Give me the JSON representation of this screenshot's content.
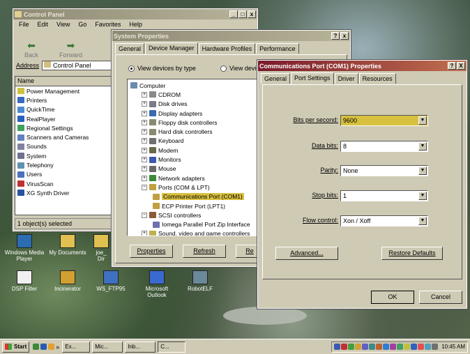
{
  "control_panel": {
    "title": "Control Panel",
    "menu": [
      "File",
      "Edit",
      "View",
      "Go",
      "Favorites",
      "Help"
    ],
    "nav": [
      "Back",
      "Forward"
    ],
    "address_label": "Address",
    "address_value": "Control Panel",
    "column_header": "Name",
    "items": [
      "Power Management",
      "Printers",
      "QuickTime",
      "RealPlayer",
      "Regional Settings",
      "Scanners and Cameras",
      "Sounds",
      "System",
      "Telephony",
      "Users",
      "VirusScan",
      "XG Synth Driver"
    ],
    "status": "1 object(s) selected"
  },
  "system_properties": {
    "title": "System Properties",
    "tabs": [
      "General",
      "Device Manager",
      "Hardware Profiles",
      "Performance"
    ],
    "view_by_type": "View devices by type",
    "view_by_connection": "View devic",
    "tree": [
      {
        "label": "Computer",
        "level": 0,
        "exp": ""
      },
      {
        "label": "CDROM",
        "level": 1,
        "exp": "+"
      },
      {
        "label": "Disk drives",
        "level": 1,
        "exp": "+"
      },
      {
        "label": "Display adapters",
        "level": 1,
        "exp": "+"
      },
      {
        "label": "Floppy disk controllers",
        "level": 1,
        "exp": "+"
      },
      {
        "label": "Hard disk controllers",
        "level": 1,
        "exp": "+"
      },
      {
        "label": "Keyboard",
        "level": 1,
        "exp": "+"
      },
      {
        "label": "Modem",
        "level": 1,
        "exp": "+"
      },
      {
        "label": "Monitors",
        "level": 1,
        "exp": "+"
      },
      {
        "label": "Mouse",
        "level": 1,
        "exp": "+"
      },
      {
        "label": "Network adapters",
        "level": 1,
        "exp": "+"
      },
      {
        "label": "Ports (COM & LPT)",
        "level": 1,
        "exp": "-"
      },
      {
        "label": "Communications Port (COM1)",
        "level": 2,
        "exp": "",
        "selected": true
      },
      {
        "label": "ECP Printer Port (LPT1)",
        "level": 2,
        "exp": ""
      },
      {
        "label": "SCSI controllers",
        "level": 1,
        "exp": "-"
      },
      {
        "label": "Iomega Parallel Port Zip Interface",
        "level": 2,
        "exp": ""
      },
      {
        "label": "Sound, video and game controllers",
        "level": 1,
        "exp": "+"
      }
    ],
    "buttons": [
      "Properties",
      "Refresh",
      "Re"
    ]
  },
  "com_properties": {
    "title": "Communications Port (COM1) Properties",
    "tabs": [
      "General",
      "Port Settings",
      "Driver",
      "Resources"
    ],
    "fields": [
      {
        "label": "Bits per second:",
        "value": "9600"
      },
      {
        "label": "Data bits:",
        "value": "8"
      },
      {
        "label": "Parity:",
        "value": "None"
      },
      {
        "label": "Stop bits:",
        "value": "1"
      },
      {
        "label": "Flow control:",
        "value": "Xon / Xoff"
      }
    ],
    "advanced": "Advanced...",
    "restore": "Restore Defaults",
    "ok": "OK",
    "cancel": "Cancel",
    "help": "?",
    "close": "X"
  },
  "desktop_icons": [
    "Windows Media Player",
    "My Documents",
    "joe_",
    "Dir",
    "DSP Filter",
    "Incinerator",
    "WS_FTP95",
    "Microsoft Outlook",
    "RobotELF"
  ],
  "taskbar": {
    "start": "Start",
    "items": [
      "Ex...",
      "Mic...",
      "Inb...",
      "C..."
    ],
    "chevron": "»",
    "clock": "10:45 AM"
  },
  "colors": {
    "active_title": "#7a1a2a",
    "highlight": "#d8c040",
    "face": "#cfcab4"
  }
}
